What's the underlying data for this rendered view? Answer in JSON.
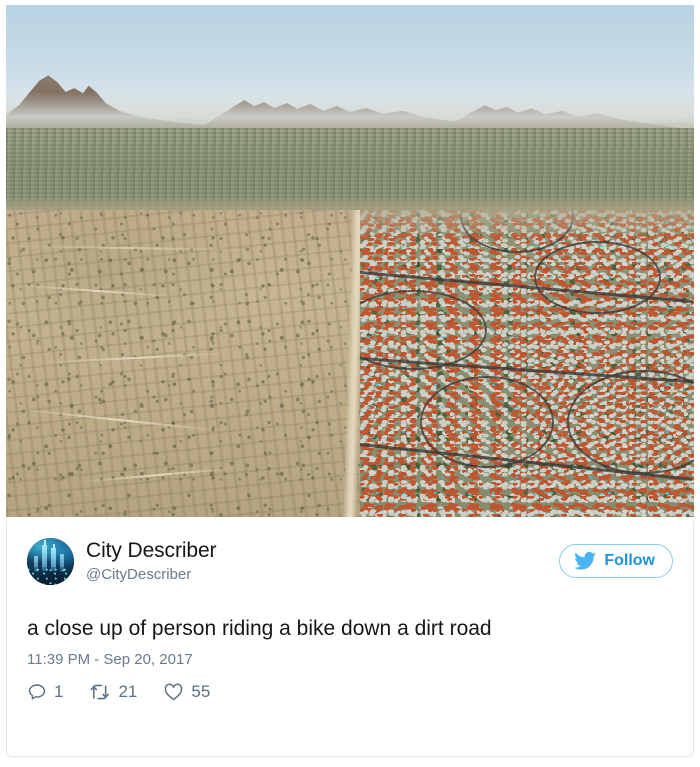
{
  "photo": {
    "alt": "aerial photograph showing a sharp boundary between undeveloped tan desert on the left and a dense suburban housing development with terracotta roofs on the right, hazy mountains on the horizon",
    "colors": {
      "sky": "#c6dae7",
      "mountain": "#7b6759",
      "desert": "#c8b693",
      "vegetation": "#8a9072",
      "roof_terracotta": "#c4552c",
      "roof_gray": "#d2d4cd",
      "road": "#3a3a3a",
      "pool": "#4fc3d9"
    }
  },
  "tweet": {
    "display_name": "City Describer",
    "handle": "@CityDescriber",
    "follow_label": "Follow",
    "text": "a close up of person riding a bike down a dirt road",
    "timestamp": "11:39 PM - Sep 20, 2017",
    "actions": [
      {
        "icon": "reply-icon",
        "count": "1",
        "name": "reply"
      },
      {
        "icon": "retweet-icon",
        "count": "21",
        "name": "retweet"
      },
      {
        "icon": "like-icon",
        "count": "55",
        "name": "like"
      }
    ],
    "colors": {
      "brand": "#1b95e0",
      "follow_border": "#8ec9f0",
      "text": "#14171a",
      "meta": "#697b8c",
      "action": "#5b7083",
      "card_border": "#e1e8ed"
    }
  }
}
